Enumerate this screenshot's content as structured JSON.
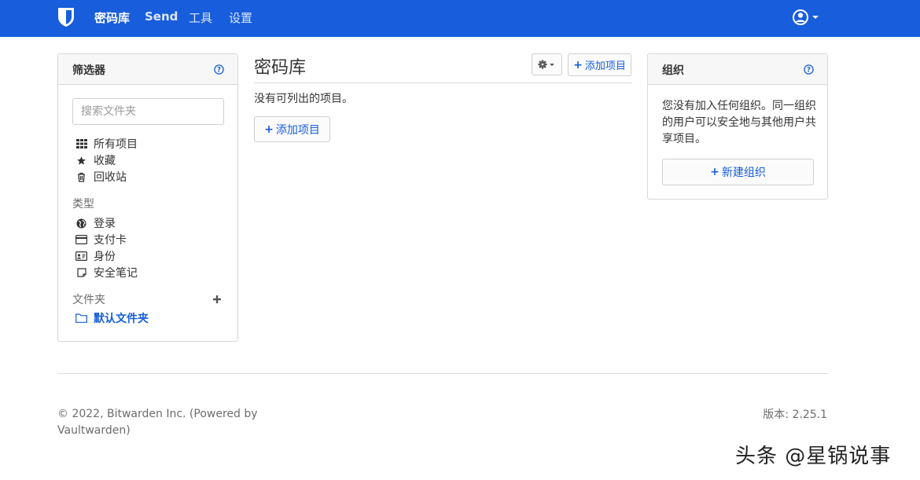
{
  "nav": {
    "links": [
      "密码库",
      "Send",
      "工具",
      "设置"
    ]
  },
  "filter": {
    "title": "筛选器",
    "search_placeholder": "搜索文件夹",
    "items": [
      "所有项目",
      "收藏",
      "回收站"
    ],
    "types_label": "类型",
    "types": [
      "登录",
      "支付卡",
      "身份",
      "安全笔记"
    ],
    "folders_label": "文件夹",
    "default_folder": "默认文件夹"
  },
  "vault": {
    "title": "密码库",
    "add_item_label": "添加项目",
    "empty_text": "没有可列出的项目。",
    "add_item_main_label": "添加项目"
  },
  "org": {
    "title": "组织",
    "description": "您没有加入任何组织。同一组织的用户可以安全地与其他用户共享项目。",
    "new_org_label": "新建组织"
  },
  "footer": {
    "copyright": "© 2022, Bitwarden Inc. (Powered by Vaultwarden)",
    "version": "版本: 2.25.1"
  },
  "watermark": "头条 @星锅说事",
  "colors": {
    "brand": "#175ddc",
    "header_bg": "#f7f7f7",
    "border": "#d7d7d7"
  },
  "icons": [
    "bitwarden-logo-icon",
    "user-circle-icon",
    "help-icon",
    "grid-icon",
    "star-icon",
    "trash-icon",
    "globe-icon",
    "credit-card-icon",
    "id-card-icon",
    "note-icon",
    "plus-icon",
    "folder-icon",
    "gear-icon"
  ]
}
